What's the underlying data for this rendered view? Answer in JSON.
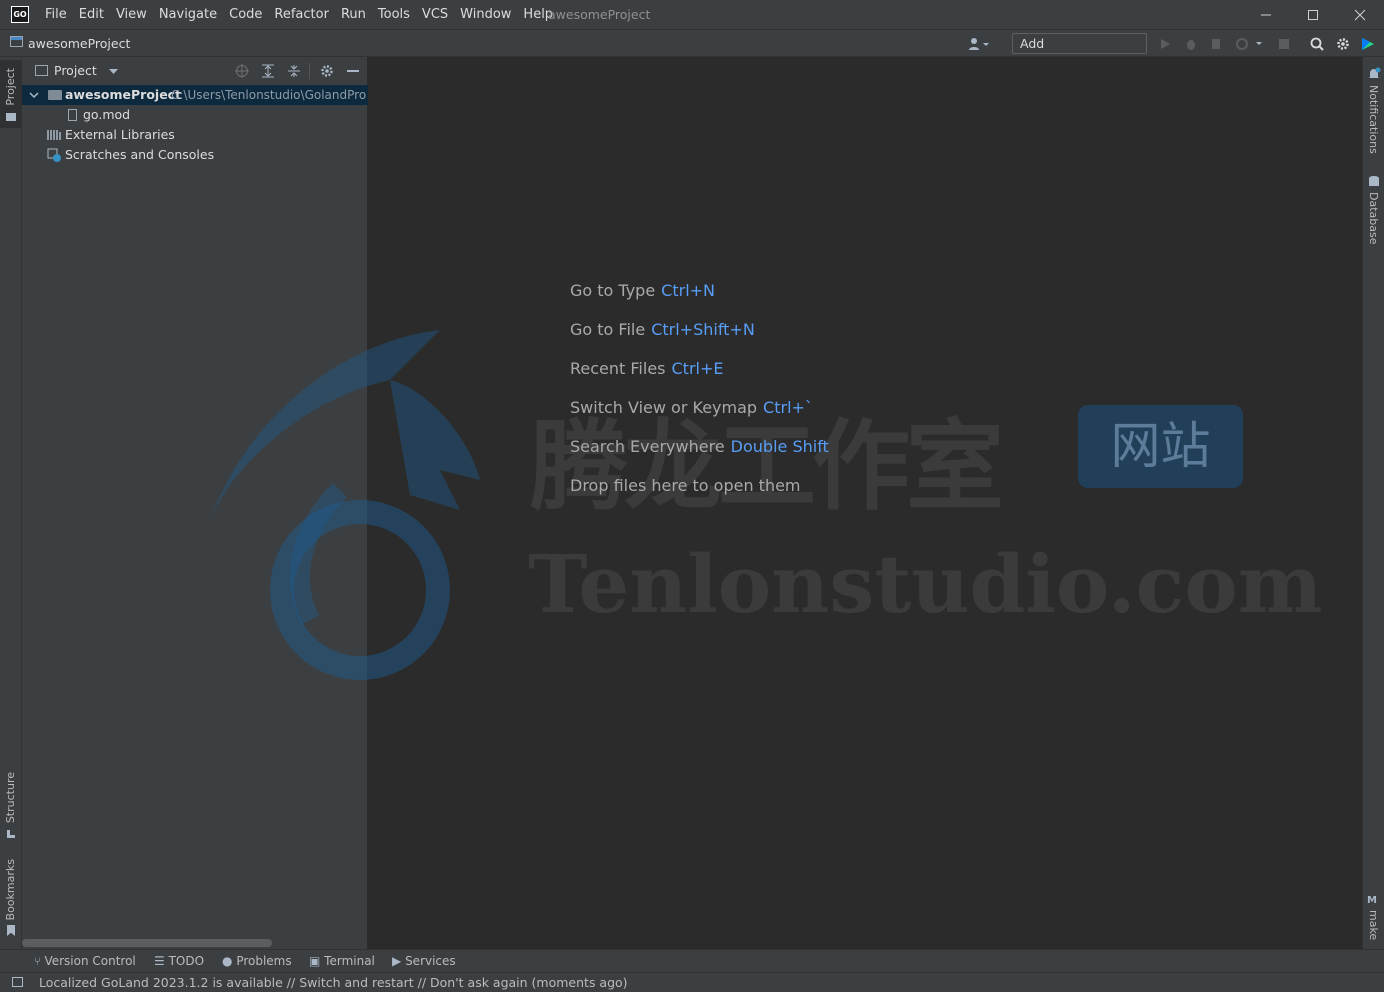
{
  "app": {
    "logo_text": "GO",
    "window_title": "awesomeProject"
  },
  "menu": [
    "File",
    "Edit",
    "View",
    "Navigate",
    "Code",
    "Refactor",
    "Run",
    "Tools",
    "VCS",
    "Window",
    "Help"
  ],
  "navbar": {
    "project": "awesomeProject",
    "add_config": "Add Configuration..."
  },
  "panel": {
    "title": "Project"
  },
  "tree": {
    "root_name": "awesomeProject",
    "root_path": "C:\\Users\\Tenlonstudio\\GolandPro",
    "gomod": "go.mod",
    "external": "External Libraries",
    "scratches": "Scratches and Consoles"
  },
  "left_tabs": {
    "project": "Project",
    "structure": "Structure",
    "bookmarks": "Bookmarks"
  },
  "right_tabs": {
    "notifications": "Notifications",
    "database": "Database",
    "make": "make"
  },
  "hints": [
    {
      "label": "Go to Type",
      "key": "Ctrl+N"
    },
    {
      "label": "Go to File",
      "key": "Ctrl+Shift+N"
    },
    {
      "label": "Recent Files",
      "key": "Ctrl+E"
    },
    {
      "label": "Switch View or Keymap",
      "key": "Ctrl+`"
    },
    {
      "label": "Search Everywhere",
      "key": "Double Shift"
    },
    {
      "label": "Drop files here to open them",
      "key": ""
    }
  ],
  "watermark": {
    "cn": "腾龙工作室",
    "badge": "网站",
    "en": "Tenlonstudio.com"
  },
  "bottom_tabs": [
    "Version Control",
    "TODO",
    "Problems",
    "Terminal",
    "Services"
  ],
  "status": "Localized GoLand 2023.1.2 is available // Switch and restart // Don't ask again (moments ago)",
  "colors": {
    "accent": "#589df6",
    "selection": "#0d293e",
    "panel": "#3c3f41",
    "editor": "#2b2b2b"
  }
}
